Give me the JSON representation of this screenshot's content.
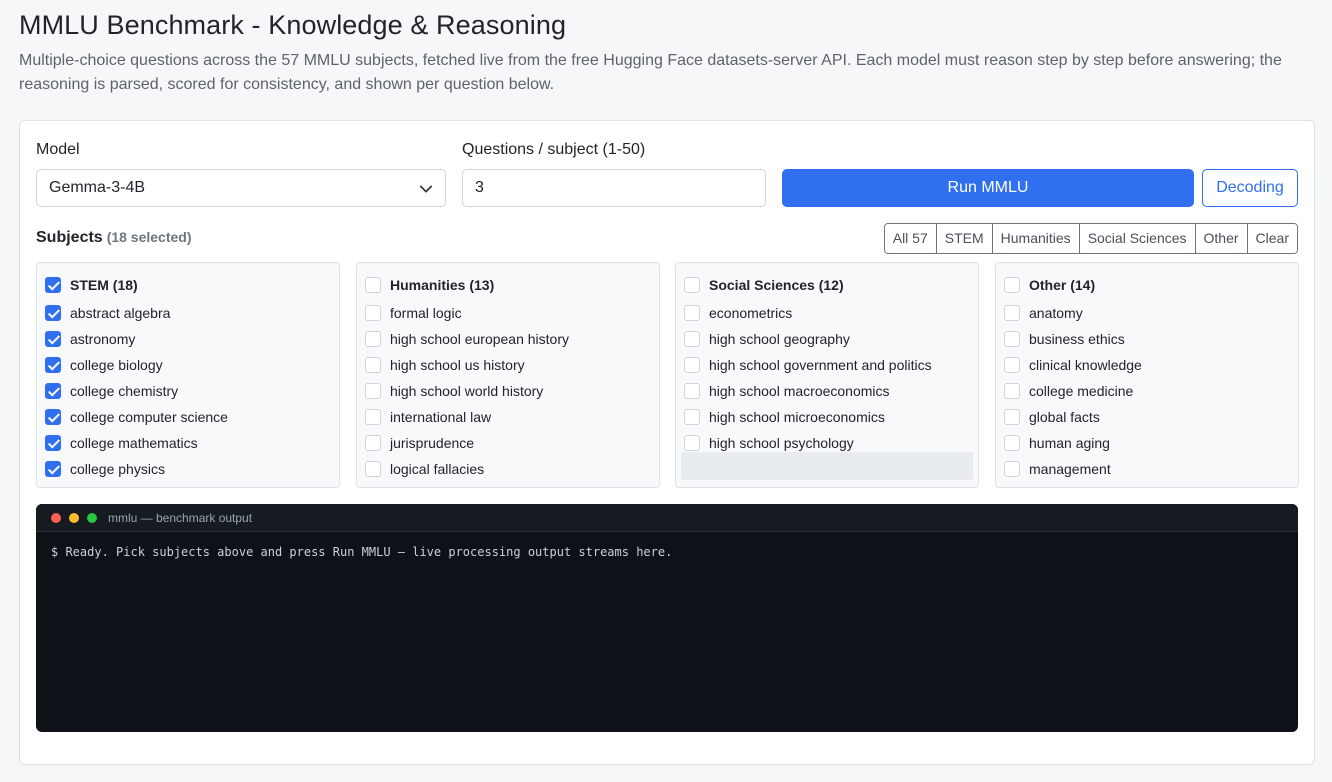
{
  "page": {
    "title": "MMLU Benchmark - Knowledge & Reasoning",
    "description": "Multiple-choice questions across the 57 MMLU subjects, fetched live from the free Hugging Face datasets-server API. Each model must reason step by step before answering; the reasoning is parsed, scored for consistency, and shown per question below."
  },
  "controls": {
    "model_label": "Model",
    "model_value": "Gemma-3-4B",
    "questions_label": "Questions / subject (1-50)",
    "questions_value": "3",
    "run_label": "Run MMLU",
    "decoding_label": "Decoding"
  },
  "subjects": {
    "label": "Subjects",
    "count_text": "(18 selected)",
    "filters": [
      "All 57",
      "STEM",
      "Humanities",
      "Social Sciences",
      "Other",
      "Clear"
    ],
    "groups": [
      {
        "title": "STEM (18)",
        "checked": true,
        "items": [
          {
            "label": "abstract algebra",
            "checked": true
          },
          {
            "label": "astronomy",
            "checked": true
          },
          {
            "label": "college biology",
            "checked": true
          },
          {
            "label": "college chemistry",
            "checked": true
          },
          {
            "label": "college computer science",
            "checked": true
          },
          {
            "label": "college mathematics",
            "checked": true
          },
          {
            "label": "college physics",
            "checked": true
          }
        ]
      },
      {
        "title": "Humanities (13)",
        "checked": false,
        "items": [
          {
            "label": "formal logic",
            "checked": false
          },
          {
            "label": "high school european history",
            "checked": false
          },
          {
            "label": "high school us history",
            "checked": false
          },
          {
            "label": "high school world history",
            "checked": false
          },
          {
            "label": "international law",
            "checked": false
          },
          {
            "label": "jurisprudence",
            "checked": false
          },
          {
            "label": "logical fallacies",
            "checked": false
          }
        ]
      },
      {
        "title": "Social Sciences (12)",
        "checked": false,
        "items": [
          {
            "label": "econometrics",
            "checked": false
          },
          {
            "label": "high school geography",
            "checked": false
          },
          {
            "label": "high school government and politics",
            "checked": false
          },
          {
            "label": "high school macroeconomics",
            "checked": false
          },
          {
            "label": "high school microeconomics",
            "checked": false
          },
          {
            "label": "high school psychology",
            "checked": false
          }
        ]
      },
      {
        "title": "Other (14)",
        "checked": false,
        "items": [
          {
            "label": "anatomy",
            "checked": false
          },
          {
            "label": "business ethics",
            "checked": false
          },
          {
            "label": "clinical knowledge",
            "checked": false
          },
          {
            "label": "college medicine",
            "checked": false
          },
          {
            "label": "global facts",
            "checked": false
          },
          {
            "label": "human aging",
            "checked": false
          },
          {
            "label": "management",
            "checked": false
          }
        ]
      }
    ]
  },
  "terminal": {
    "title": "mmlu — benchmark output",
    "output": "$ Ready. Pick subjects above and press Run MMLU — live processing output streams here.",
    "dot_colors": [
      "#ff5f57",
      "#febc2e",
      "#28c840"
    ]
  },
  "colors": {
    "accent": "#2f6ff0",
    "terminal_bg": "#0e1117"
  }
}
